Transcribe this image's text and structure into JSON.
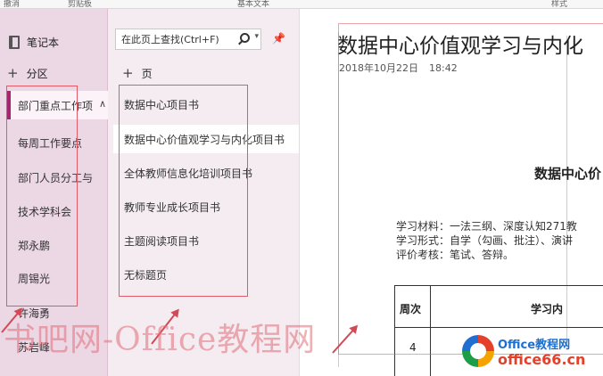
{
  "ribbon": {
    "labels": [
      "撤消",
      "剪贴板",
      "基本文本",
      "样式"
    ]
  },
  "sidebar": {
    "notebook_label": "笔记本",
    "add_section_label": "分区",
    "sections": [
      {
        "label": "部门重点工作项"
      },
      {
        "label": "每周工作要点"
      },
      {
        "label": "部门人员分工与"
      },
      {
        "label": "技术学科会"
      },
      {
        "label": "郑永鹏"
      },
      {
        "label": "周锡光"
      },
      {
        "label": "许海勇"
      },
      {
        "label": "苏岩峰"
      }
    ],
    "collapse_glyph": "∧"
  },
  "pages_pane": {
    "search_placeholder": "在此页上查找(Ctrl+F)",
    "add_page_label": "页",
    "pages": [
      {
        "label": "数据中心项目书"
      },
      {
        "label": "数据中心价值观学习与内化项目书"
      },
      {
        "label": "全体教师信息化培训项目书"
      },
      {
        "label": "教师专业成长项目书"
      },
      {
        "label": "主题阅读项目书"
      },
      {
        "label": "无标题页"
      }
    ]
  },
  "note": {
    "title": "数据中心价值观学习与内化",
    "date": "2018年10月22日",
    "time": "18:42",
    "heading": "数据中心价",
    "lines": [
      "学习材料：一法三纲、深度认知271教",
      "学习形式：自学（勾画、批注）、演讲",
      "评价考核：笔试、答辩。"
    ],
    "table": {
      "col1_header": "周次",
      "col2_header": "学习内",
      "row1_col1": "4"
    }
  },
  "watermark": {
    "text": "书吧网-Office教程网",
    "logo_top": "Office教程网",
    "logo_bottom": "office66.cn"
  },
  "colors": {
    "accent": "#a3266e",
    "annotation": "#e05a68"
  }
}
